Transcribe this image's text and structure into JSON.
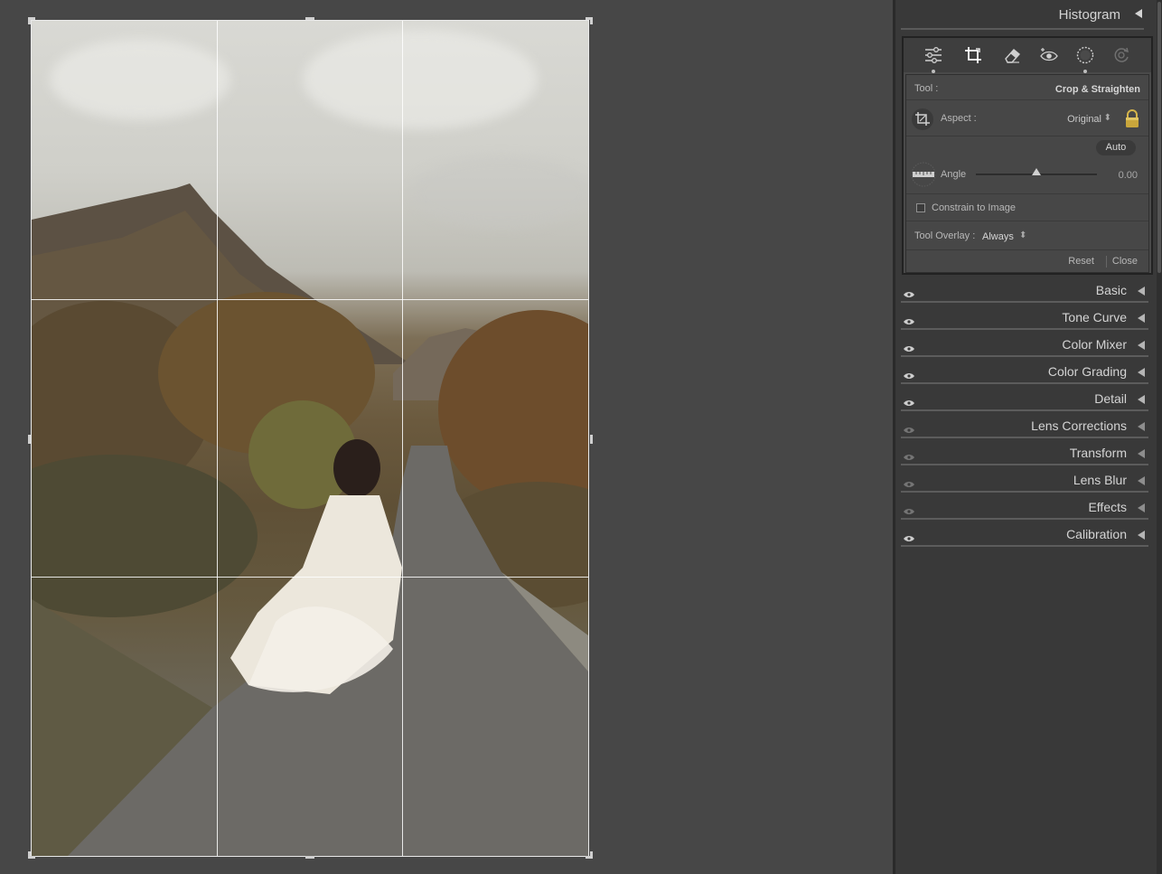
{
  "panel": {
    "histogram_label": "Histogram",
    "tool_row": {
      "label": "Tool :",
      "value": "Crop & Straighten"
    },
    "aspect_row": {
      "label": "Aspect :",
      "value": "Original",
      "stepper": "⬍"
    },
    "auto_button": "Auto",
    "angle_row": {
      "label": "Angle",
      "value": "0.00",
      "slider_fraction": 0.5
    },
    "constrain": {
      "label": "Constrain to Image",
      "checked": false
    },
    "overlay_row": {
      "label": "Tool Overlay :",
      "value": "Always",
      "stepper": "⬍"
    },
    "footer": {
      "reset": "Reset",
      "close": "Close"
    },
    "toolbar_icons": [
      "edit-sliders-icon",
      "crop-icon",
      "healing-eraser-icon",
      "red-eye-icon",
      "masking-icon",
      "presets-icon"
    ],
    "sections": [
      {
        "name": "Basic",
        "visible": true
      },
      {
        "name": "Tone Curve",
        "visible": true
      },
      {
        "name": "Color Mixer",
        "visible": true
      },
      {
        "name": "Color Grading",
        "visible": true
      },
      {
        "name": "Detail",
        "visible": true
      },
      {
        "name": "Lens Corrections",
        "visible": false
      },
      {
        "name": "Transform",
        "visible": false
      },
      {
        "name": "Lens Blur",
        "visible": false
      },
      {
        "name": "Effects",
        "visible": false
      },
      {
        "name": "Calibration",
        "visible": true
      }
    ]
  },
  "colors": {
    "canvas_bg": "#474747",
    "panel_bg": "#393939",
    "text": "#d4d4d4",
    "grid_line": "#ffffff"
  }
}
